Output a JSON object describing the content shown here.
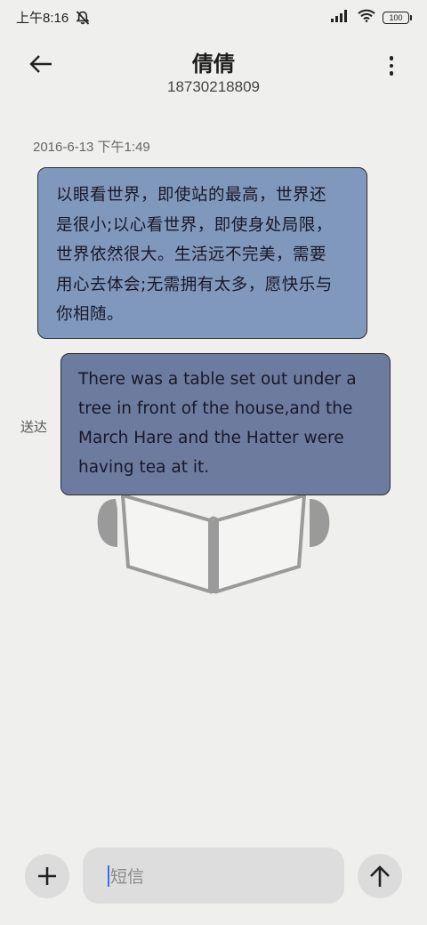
{
  "status_bar": {
    "time": "上午8:16",
    "battery": "100",
    "icons": [
      "silent-bell-icon",
      "signal-icon",
      "wifi-icon",
      "battery-icon"
    ]
  },
  "header": {
    "contact_name": "倩倩",
    "contact_number": "18730218809",
    "icons": [
      "back-arrow-icon",
      "more-vert-icon"
    ]
  },
  "conversation": {
    "timestamp": "2016-6-13 下午1:49",
    "messages": [
      {
        "type": "received",
        "color": "#8198bd",
        "lines": [
          "以眼看世界，即使站的最高，世界还",
          "是很小;以心看世界，即使身处局限，",
          "世界依然很大。生活远不完美，需要",
          "用心去体会;无需拥有太多，愿快乐与",
          "你相随。"
        ]
      },
      {
        "type": "sent",
        "color": "#6d7b9e",
        "status": "送达",
        "lines": [
          "There was a table set out under a",
          "tree in front of the house,and the",
          "March Hare and the Hatter were",
          "having tea at it."
        ]
      }
    ]
  },
  "composer": {
    "placeholder": "短信",
    "icons": [
      "add-icon",
      "send-arrow-icon"
    ]
  }
}
